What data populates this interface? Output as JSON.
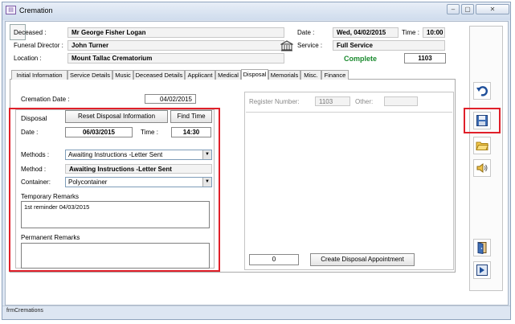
{
  "window": {
    "title": "Cremation",
    "status_text": "frmCremations",
    "controls": [
      "minimize-icon",
      "maximize-icon",
      "close-icon"
    ]
  },
  "header": {
    "deceased_label": "Deceased :",
    "deceased_value": "Mr George Fisher Logan",
    "funeral_director_label": "Funeral Director :",
    "funeral_director_value": "John Turner",
    "location_label": "Location :",
    "location_value": "Mount Tallac Crematorium",
    "date_label": "Date :",
    "date_value": "Wed, 04/02/2015",
    "time_label": "Time :",
    "time_value": "10:00",
    "service_label": "Service :",
    "service_value": "Full Service",
    "status_value": "Complete",
    "number_value": "1103",
    "status_color": "#1a8a2e"
  },
  "tabs": [
    "Initial Information",
    "Service Details",
    "Music",
    "Deceased Details",
    "Applicant",
    "Medical",
    "Disposal",
    "Memorials",
    "Misc.",
    "Finance"
  ],
  "active_tab": "Disposal",
  "disposal": {
    "cremation_date_label": "Cremation Date :",
    "cremation_date_value": "04/02/2015",
    "section_label": "Disposal",
    "reset_button": "Reset Disposal Information",
    "find_time_button": "Find Time",
    "date_label": "Date :",
    "date_value": "06/03/2015",
    "time_label": "Time :",
    "time_value": "14:30",
    "methods_label": "Methods :",
    "methods_value": "Awaiting Instructions -Letter Sent",
    "method_label": "Method :",
    "method_value": "Awaiting Instructions -Letter Sent",
    "container_label": "Container:",
    "container_value": "Polycontainer",
    "temp_remarks_label": "Temporary Remarks",
    "temp_remarks_value": "1st reminder  04/03/2015",
    "perm_remarks_label": "Permanent Remarks",
    "perm_remarks_value": ""
  },
  "register": {
    "register_number_label": "Register Number:",
    "register_number_value": "1103",
    "other_label": "Other:",
    "other_value": "",
    "count_value": "0",
    "create_button": "Create Disposal Appointment"
  },
  "sidebar": {
    "buttons": [
      "undo-icon",
      "save-icon",
      "open-folder-icon",
      "sound-icon",
      "exit-door-icon",
      "next-arrow-icon"
    ]
  },
  "colors": {
    "highlight_red": "#e0202a",
    "complete_green": "#1a8a2e"
  }
}
